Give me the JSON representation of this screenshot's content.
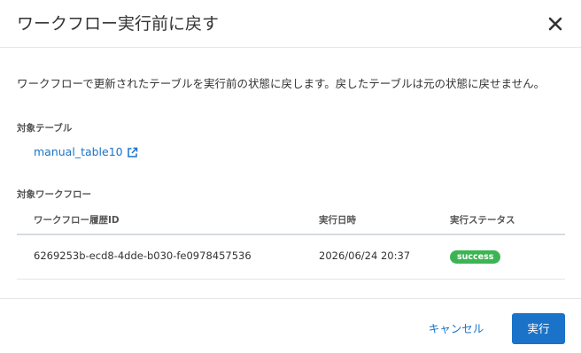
{
  "dialog": {
    "title": "ワークフロー実行前に戻す",
    "close_icon": "close-icon",
    "description": "ワークフローで更新されたテーブルを実行前の状態に戻します。戻したテーブルは元の状態に戻せません。"
  },
  "target_table": {
    "label": "対象テーブル",
    "name": "manual_table10",
    "link_icon": "external-link-icon"
  },
  "target_workflow": {
    "label": "対象ワークフロー",
    "columns": [
      "ワークフロー履歴ID",
      "実行日時",
      "実行ステータス"
    ],
    "rows": [
      {
        "history_id": "6269253b-ecd8-4dde-b030-fe0978457536",
        "executed_at": "2026/06/24 20:37",
        "status": "success"
      }
    ]
  },
  "footer": {
    "cancel_label": "キャンセル",
    "execute_label": "実行"
  },
  "colors": {
    "accent": "#1a73c8",
    "success": "#3db454",
    "divider": "#e3e6ea"
  }
}
